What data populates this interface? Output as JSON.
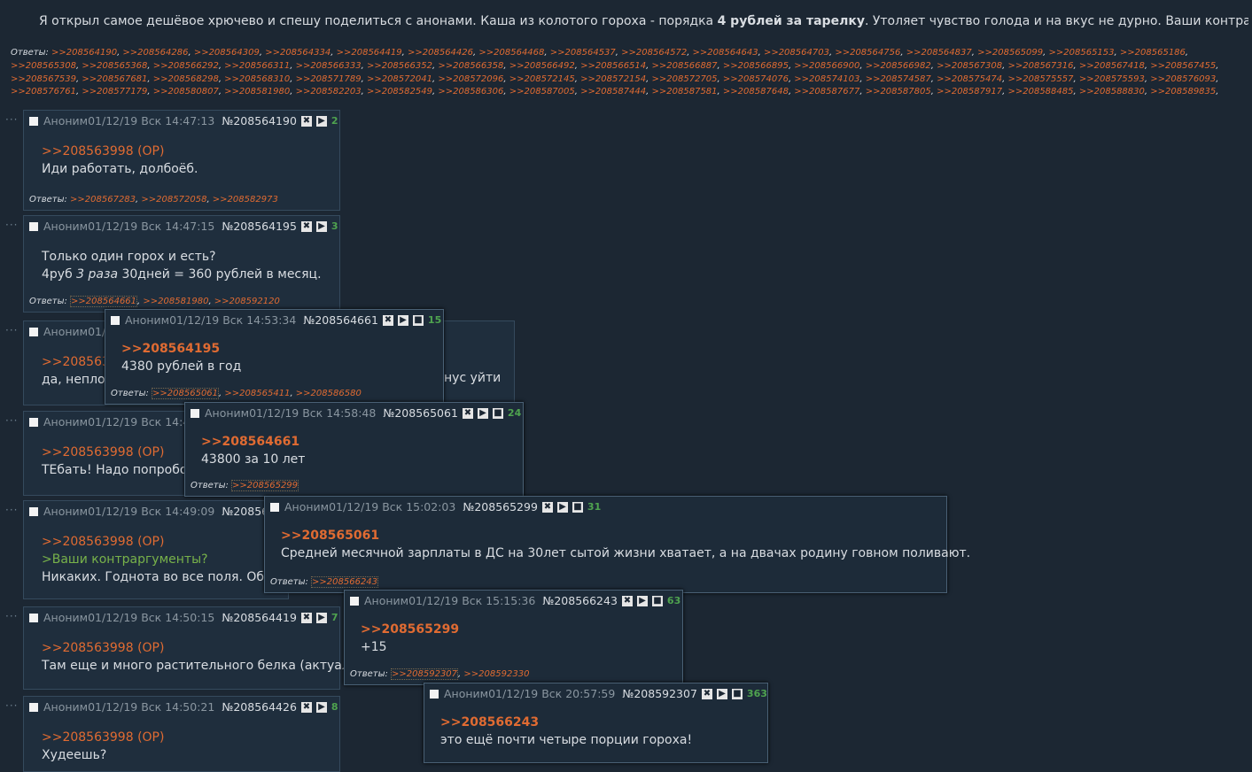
{
  "op": {
    "text_a": "Я открыл самое дешёвое хрючево и спешу поделиться с анонами. Каша из колотого гороха - порядка ",
    "text_bold": "4 рублей за тарелку",
    "text_b": ". Утоляет чувство голода и на вкус не дурно. Ваши контраргументы?",
    "replies_label": "Ответы:",
    "replies": [
      ">>208564190",
      ">>208564286",
      ">>208564309",
      ">>208564334",
      ">>208564419",
      ">>208564426",
      ">>208564468",
      ">>208564537",
      ">>208564572",
      ">>208564643",
      ">>208564703",
      ">>208564756",
      ">>208564837",
      ">>208565099",
      ">>208565153",
      ">>208565186",
      ">>208565308",
      ">>208565368",
      ">>208566292",
      ">>208566311",
      ">>208566333",
      ">>208566352",
      ">>208566358",
      ">>208566492",
      ">>208566514",
      ">>208566887",
      ">>208566895",
      ">>208566900",
      ">>208566982",
      ">>208567308",
      ">>208567316",
      ">>208567418",
      ">>208567455",
      ">>208567539",
      ">>208567681",
      ">>208568298",
      ">>208568310",
      ">>208571789",
      ">>208572041",
      ">>208572096",
      ">>208572145",
      ">>208572154",
      ">>208572705",
      ">>208574076",
      ">>208574103",
      ">>208574587",
      ">>208575474",
      ">>208575557",
      ">>208575593",
      ">>208576093",
      ">>208576761",
      ">>208577179",
      ">>208580807",
      ">>208581980",
      ">>208582203",
      ">>208582549",
      ">>208586306",
      ">>208587005",
      ">>208587444",
      ">>208587581",
      ">>208587648",
      ">>208587677",
      ">>208587805",
      ">>208587917",
      ">>208588485",
      ">>208588830",
      ">>208589835",
      ">>208590825",
      ">>208591465",
      ">>208591515",
      ">>208592156",
      ">>208592230",
      ">>208592645",
      ">>208592670",
      ">>208593402"
    ]
  },
  "posts": [
    {
      "name": "Аноним",
      "date": "01/12/19 Вск 14:47:13",
      "num": "№208564190",
      "count": "2",
      "ref": ">>208563998 (OP)",
      "lines": [
        "Иди работать, долбоёб."
      ],
      "replies": [
        ">>208567283",
        ">>208572058",
        ">>208582973"
      ]
    },
    {
      "name": "Аноним",
      "date": "01/12/19 Вск 14:47:15",
      "num": "№208564195",
      "count": "3",
      "lines": [
        "Только один горох и есть?"
      ],
      "line2_a": "4руб ",
      "line2_i": "3 раза",
      "line2_b": " 30дней = 360 рублей в месяц.",
      "replies": [
        ">>208564661",
        ">>208581980",
        ">>208592120"
      ]
    },
    {
      "name": "Аноним",
      "date": "01/",
      "ref": ">>2085639",
      "line": "да, неплох",
      "tail": "нус уйти"
    },
    {
      "name": "Аноним",
      "date": "01/12/19 Вск 14:4",
      "ref": ">>208563998 (OP)",
      "line": "ТЕбать! Надо попробов"
    },
    {
      "name": "Аноним",
      "date": "01/12/19 Вск 14:49:09",
      "num": "№20856",
      "ref": ">>208563998 (OP)",
      "green": ">Ваши контраргументы?",
      "line": "Никаких. Годнота во все поля. Обо"
    },
    {
      "name": "Аноним",
      "date": "01/12/19 Вск 14:50:15",
      "num": "№208564419",
      "count": "7",
      "ref": ">>208563998 (OP)",
      "line": "Там еще и много растительного белка (актуальн"
    },
    {
      "name": "Аноним",
      "date": "01/12/19 Вск 14:50:21",
      "num": "№208564426",
      "count": "8",
      "ref": ">>208563998 (OP)",
      "line": "Худеешь?"
    }
  ],
  "popups": [
    {
      "name": "Аноним",
      "date": "01/12/19 Вск 14:53:34",
      "num": "№208564661",
      "count": "15",
      "ref": ">>208564195",
      "line": "4380 рублей в год",
      "replies": [
        ">>208565061",
        ">>208565411",
        ">>208586580"
      ]
    },
    {
      "name": "Аноним",
      "date": "01/12/19 Вск 14:58:48",
      "num": "№208565061",
      "count": "24",
      "ref": ">>208564661",
      "line": "43800 за 10 лет",
      "replies": [
        ">>208565299"
      ]
    },
    {
      "name": "Аноним",
      "date": "01/12/19 Вск 15:02:03",
      "num": "№208565299",
      "count": "31",
      "ref": ">>208565061",
      "line": "Средней месячной зарплаты в ДС на 30лет сытой жизни хватает, а на двачах родину говном поливают.",
      "replies": [
        ">>208566243"
      ]
    },
    {
      "name": "Аноним",
      "date": "01/12/19 Вск 15:15:36",
      "num": "№208566243",
      "count": "63",
      "ref": ">>208565299",
      "line": "+15",
      "replies": [
        ">>208592307",
        ">>208592330"
      ]
    },
    {
      "name": "Аноним",
      "date": "01/12/19 Вск 20:57:59",
      "num": "№208592307",
      "count": "363",
      "ref": ">>208566243",
      "line": "это ещё почти четыре порции гороха!"
    }
  ],
  "labels": {
    "replies": "Ответы:",
    "dots": "···",
    "comma": ", "
  }
}
